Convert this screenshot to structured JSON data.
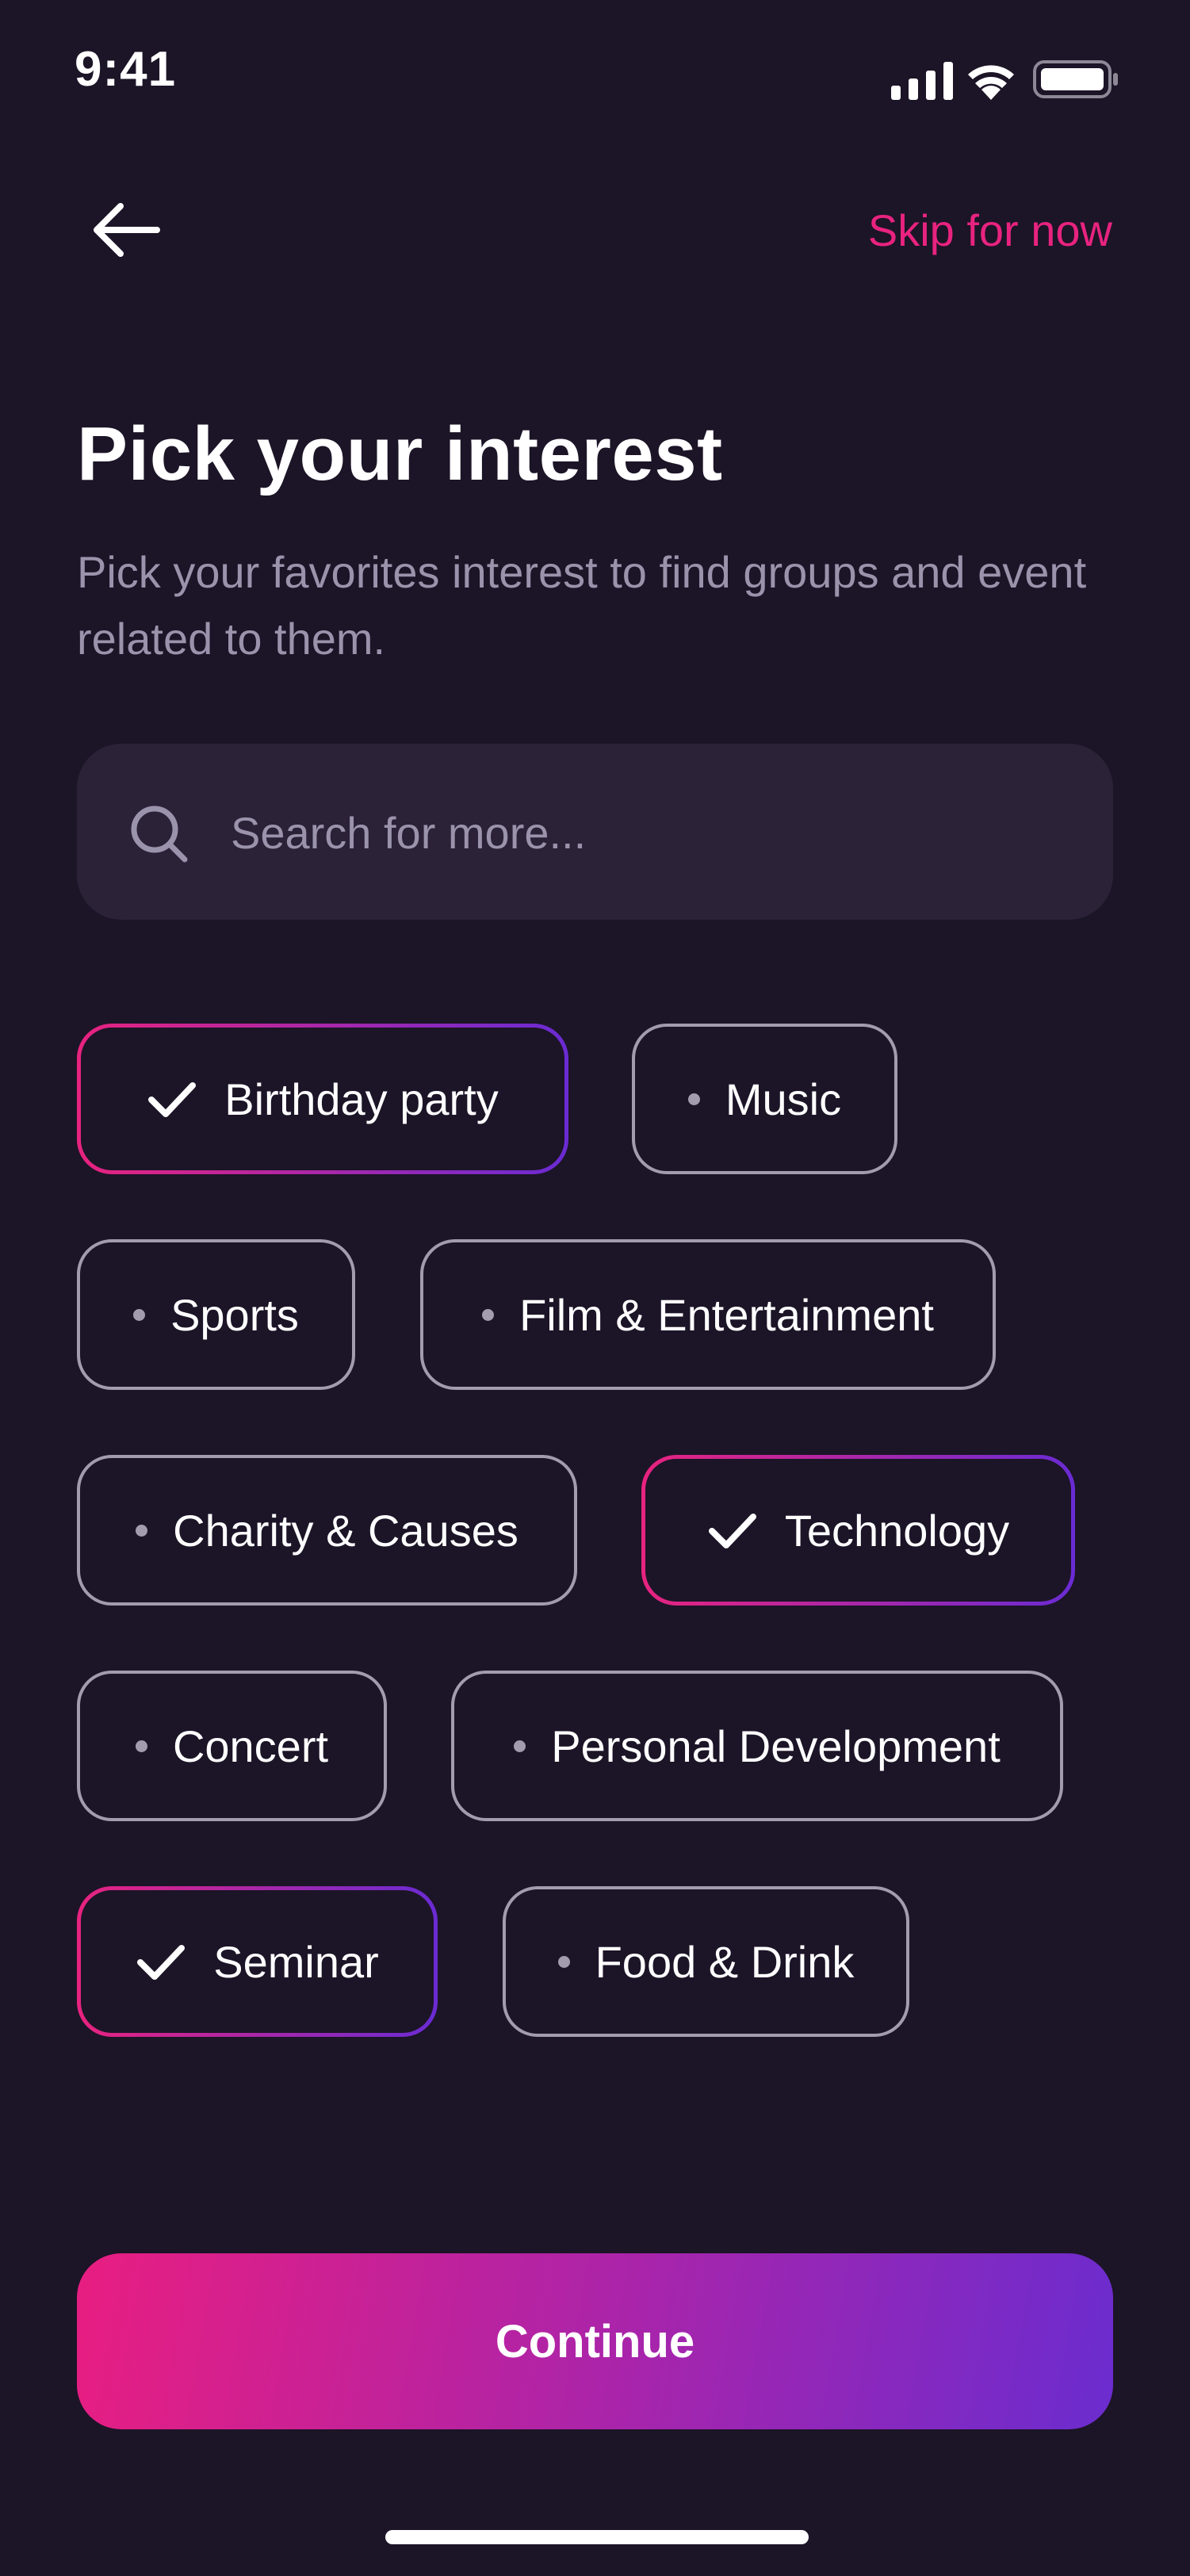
{
  "status_bar": {
    "time": "9:41",
    "icons": [
      "cellular-signal-icon",
      "wifi-icon",
      "battery-icon"
    ]
  },
  "nav": {
    "back_icon": "arrow-left-icon",
    "skip_label": "Skip for now"
  },
  "header": {
    "title": "Pick your interest",
    "subtitle": "Pick your favorites interest to find groups and event related to them."
  },
  "search": {
    "icon": "search-icon",
    "placeholder": "Search for more..."
  },
  "interests": [
    {
      "label": "Birthday party",
      "selected": true
    },
    {
      "label": "Music",
      "selected": false
    },
    {
      "label": "Sports",
      "selected": false
    },
    {
      "label": "Film & Entertainment",
      "selected": false
    },
    {
      "label": "Charity & Causes",
      "selected": false
    },
    {
      "label": "Technology",
      "selected": true
    },
    {
      "label": "Concert",
      "selected": false
    },
    {
      "label": "Personal Development",
      "selected": false
    },
    {
      "label": "Seminar",
      "selected": true
    },
    {
      "label": "Food & Drink",
      "selected": false
    }
  ],
  "actions": {
    "continue_label": "Continue"
  },
  "colors": {
    "background": "#1c1427",
    "accent_pink": "#e8237f",
    "accent_purple": "#6a2bd3",
    "search_bg": "#2b2238",
    "muted_text": "#9b93ab",
    "chip_border": "#a29cae"
  }
}
